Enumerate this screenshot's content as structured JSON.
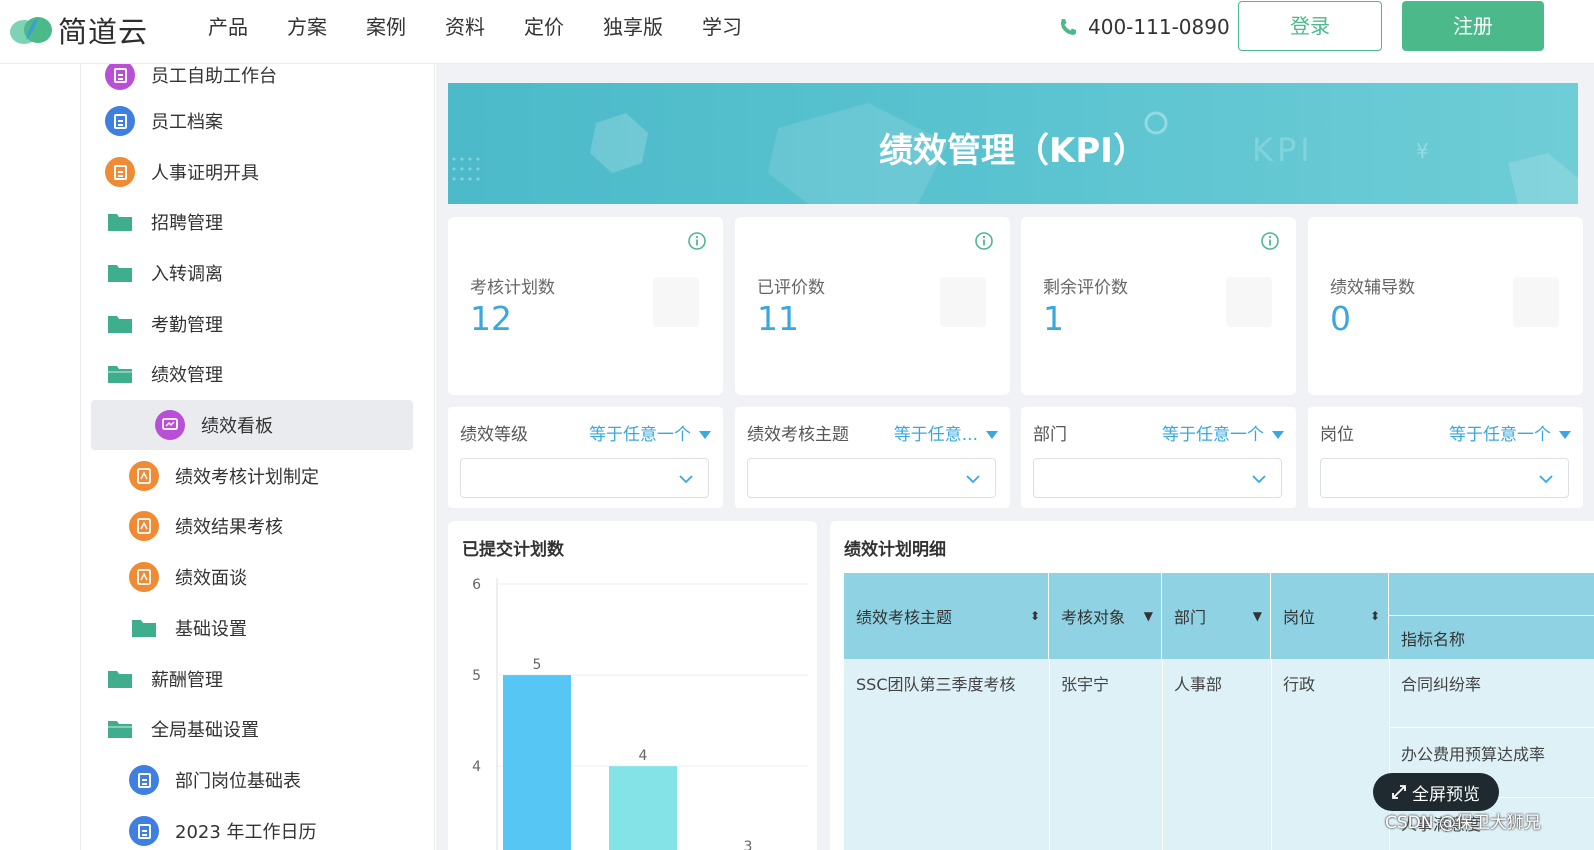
{
  "brand": {
    "name": "简道云"
  },
  "nav": {
    "items": [
      "产品",
      "方案",
      "案例",
      "资料",
      "定价",
      "独享版",
      "学习"
    ]
  },
  "phone": "400-111-0890",
  "auth": {
    "login": "登录",
    "register": "注册"
  },
  "sidebar": {
    "items": [
      {
        "label": "员工自助工作台",
        "icon": "form-icon",
        "color": "#b94fd6"
      },
      {
        "label": "员工档案",
        "icon": "form-icon",
        "color": "#3e7fe0"
      },
      {
        "label": "人事证明开具",
        "icon": "form-icon",
        "color": "#ef8a35"
      },
      {
        "label": "招聘管理",
        "icon": "folder-icon",
        "color": "#3fae8c"
      },
      {
        "label": "入转调离",
        "icon": "folder-icon",
        "color": "#3fae8c"
      },
      {
        "label": "考勤管理",
        "icon": "folder-icon",
        "color": "#3fae8c"
      },
      {
        "label": "绩效管理",
        "icon": "folder-open-icon",
        "color": "#3fae8c"
      },
      {
        "label": "绩效看板",
        "icon": "dashboard-icon",
        "color": "#b94fd6"
      },
      {
        "label": "绩效考核计划制定",
        "icon": "workflow-icon",
        "color": "#ef8a35"
      },
      {
        "label": "绩效结果考核",
        "icon": "workflow-icon",
        "color": "#ef8a35"
      },
      {
        "label": "绩效面谈",
        "icon": "workflow-icon",
        "color": "#ef8a35"
      },
      {
        "label": "基础设置",
        "icon": "folder-icon",
        "color": "#3fae8c"
      },
      {
        "label": "薪酬管理",
        "icon": "folder-icon",
        "color": "#3fae8c"
      },
      {
        "label": "全局基础设置",
        "icon": "folder-open-icon",
        "color": "#3fae8c"
      },
      {
        "label": "部门岗位基础表",
        "icon": "form-icon",
        "color": "#3e7fe0"
      },
      {
        "label": "2023 年工作日历",
        "icon": "form-icon",
        "color": "#3e7fe0"
      }
    ]
  },
  "banner": {
    "title": "绩效管理（KPI）",
    "deco_text": "KPI",
    "deco_symbol": "¥"
  },
  "kpis": [
    {
      "label": "考核计划数",
      "value": "12"
    },
    {
      "label": "已评价数",
      "value": "11"
    },
    {
      "label": "剩余评价数",
      "value": "1"
    },
    {
      "label": "绩效辅导数",
      "value": "0"
    }
  ],
  "filters": [
    {
      "name": "绩效等级",
      "op": "等于任意一个"
    },
    {
      "name": "绩效考核主题",
      "op": "等于任意..."
    },
    {
      "name": "部门",
      "op": "等于任意一个"
    },
    {
      "name": "岗位",
      "op": "等于任意一个"
    }
  ],
  "chart_card": {
    "title": "已提交计划数"
  },
  "chart_data": {
    "type": "bar",
    "title": "已提交计划数",
    "categories": [
      "",
      "",
      ""
    ],
    "values": [
      5,
      4,
      3
    ],
    "colors": [
      "#56c6f4",
      "#84e3e6",
      "#c4f5cd"
    ],
    "yticks": [
      3,
      4,
      5,
      6
    ],
    "ylim": [
      2.3,
      6
    ],
    "grid": true
  },
  "table_card": {
    "title": "绩效计划明细",
    "headers": [
      "绩效考核主题",
      "考核对象",
      "部门",
      "岗位",
      "",
      "指标名称"
    ],
    "rows": [
      {
        "topic": "SSC团队第三季度考核",
        "person": "张宇宁",
        "dept": "人事部",
        "post": "行政",
        "indicators": [
          "合同纠纷率",
          "办公费用预算达成率",
          "人事满意度"
        ]
      }
    ]
  },
  "fullscreen": "全屏预览",
  "watermark": "CSDN @保卫大狮兄",
  "colors": {
    "accent": "#4cb98a",
    "value_blue": "#3aa8df",
    "banner": "#52bfcc"
  }
}
